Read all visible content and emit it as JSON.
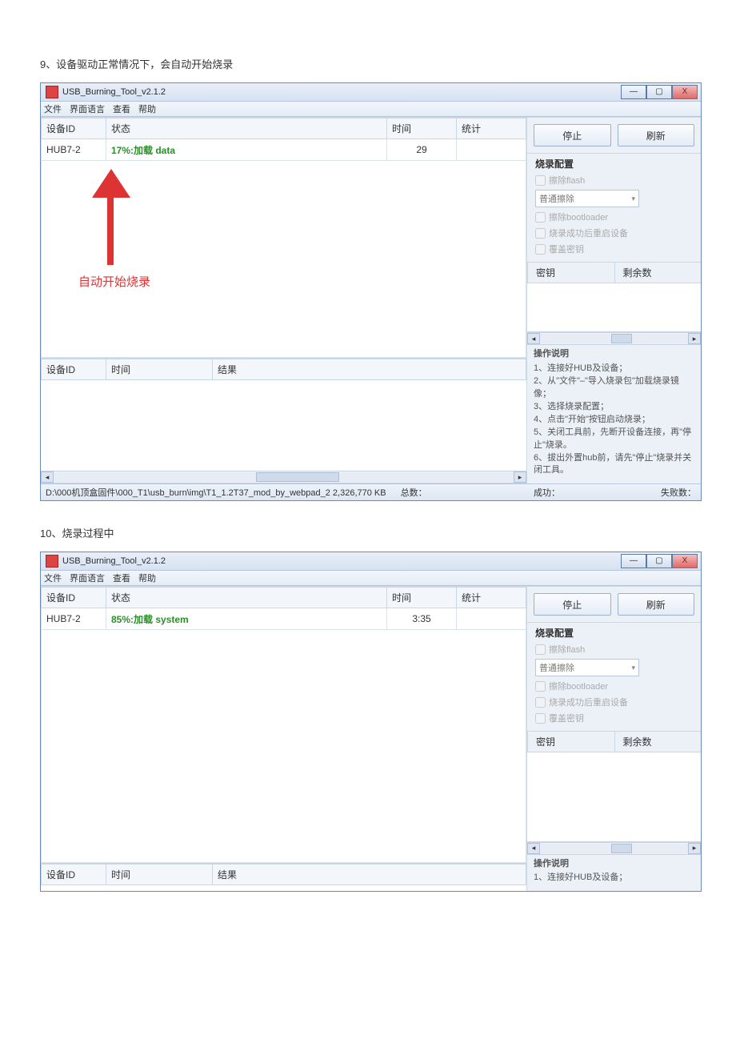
{
  "doc": {
    "caption9": "9、设备驱动正常情况下，会自动开始烧录",
    "caption10": "10、烧录过程中"
  },
  "app": {
    "title": "USB_Burning_Tool_v2.1.2",
    "menu": {
      "file": "文件",
      "lang": "界面语言",
      "view": "查看",
      "help": "帮助"
    },
    "winbtn": {
      "min": "—",
      "max": "▢",
      "close": "X"
    },
    "headers": {
      "devid": "设备ID",
      "status": "状态",
      "time": "时间",
      "stat": "统计",
      "result": "结果"
    },
    "right": {
      "stop": "停止",
      "refresh": "刷新",
      "config_title": "烧录配置",
      "erase_flash": "擦除flash",
      "erase_mode": "普通擦除",
      "erase_bootloader": "擦除bootloader",
      "reboot_after": "烧录成功后重启设备",
      "override_key": "覆盖密钥",
      "key_col1": "密钥",
      "key_col2": "剩余数",
      "instr_title": "操作说明",
      "instr_1": "1、连接好HUB及设备；",
      "instr_2": "2、从\"文件\"–\"导入烧录包\"加载烧录镜像；",
      "instr_3": "3、选择烧录配置；",
      "instr_4": "4、点击\"开始\"按钮启动烧录；",
      "instr_5": "5、关闭工具前，先断开设备连接，再\"停止\"烧录。",
      "instr_6": "6、拔出外置hub前，请先\"停止\"烧录并关闭工具。",
      "instr_short_1": "1、连接好HUB及设备；"
    },
    "status": {
      "path_label": "D:\\000机顶盒固件\\000_T1\\usb_burn\\img\\T1_1.2T37_mod_by_webpad_2 2,326,770 KB",
      "total_label": "总数：",
      "success_label": "成功：",
      "fail_label": "失败数："
    }
  },
  "shot1": {
    "device": "HUB7-2",
    "status_text": "17%:加载 data",
    "time": "29",
    "arrow_label": "自动开始烧录"
  },
  "shot2": {
    "device": "HUB7-2",
    "status_text": "85%:加载 system",
    "time": "3:35"
  }
}
